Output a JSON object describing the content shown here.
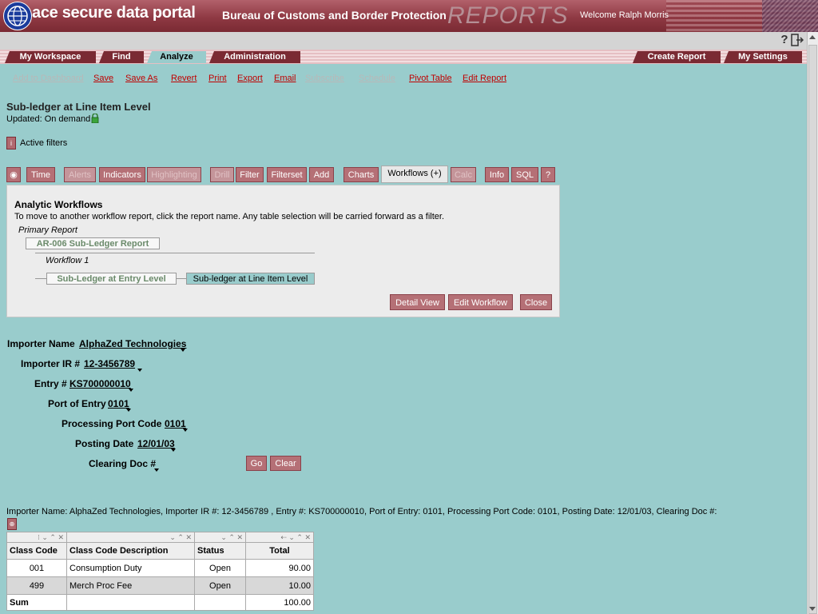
{
  "header": {
    "brand": "ace secure data portal",
    "agency": "Bureau of Customs and Border Protection",
    "reports": "REPORTS",
    "welcome": "Welcome Ralph Morris"
  },
  "nav": {
    "tabs": [
      "My Workspace",
      "Find",
      "Analyze",
      "Administration"
    ],
    "right_tabs": [
      "Create Report",
      "My Settings"
    ]
  },
  "actions": {
    "disabled_1": "Add to Dashboard",
    "save": "Save",
    "save_as": "Save As",
    "revert": "Revert",
    "print": "Print",
    "export": "Export",
    "email": "Email",
    "disabled_2": "Subscribe",
    "disabled_3": "Schedule",
    "pivot": "Pivot Table",
    "edit": "Edit Report"
  },
  "report": {
    "title": "Sub-ledger at Line Item Level",
    "updated": "Updated: On demand",
    "active_filters": "Active filters"
  },
  "toolbar": {
    "time": "Time",
    "alerts": "Alerts",
    "indicators": "Indicators",
    "highlighting": "Highlighting",
    "drill": "Drill",
    "filter": "Filter",
    "filterset": "Filterset",
    "add": "Add",
    "charts": "Charts",
    "workflows": "Workflows (+)",
    "calc": "Calc",
    "info": "Info",
    "sql": "SQL",
    "help": "?"
  },
  "workflow": {
    "title": "Analytic Workflows",
    "description": "To move to another workflow report, click the report name. Any table selection will be carried forward as a filter.",
    "primary_label": "Primary Report",
    "primary_report": "AR-006 Sub-Ledger Report",
    "workflow_label": "Workflow 1",
    "step_1": "Sub-Ledger at Entry Level",
    "step_2": "Sub-ledger at Line Item Level",
    "detail_view": "Detail View",
    "edit_workflow": "Edit Workflow",
    "close": "Close"
  },
  "prompts": {
    "importer_name_label": "Importer Name",
    "importer_name": "AlphaZed Technologies",
    "importer_ir_label": "Importer IR #",
    "importer_ir": "12-3456789",
    "entry_label": "Entry #",
    "entry": "KS700000010",
    "port_label": "Port of Entry",
    "port": "0101",
    "proc_port_label": "Processing Port Code",
    "proc_port": "0101",
    "posting_date_label": "Posting Date",
    "posting_date": "12/01/03",
    "clearing_doc_label": "Clearing Doc #",
    "go": "Go",
    "clear": "Clear"
  },
  "summary": "Importer Name: AlphaZed Technologies, Importer IR #: 12-3456789 , Entry #: KS700000010, Port of Entry: 0101, Processing Port Code: 0101, Posting Date: 12/01/03, Clearing Doc #:",
  "table": {
    "columns": [
      "Class Code",
      "Class Code Description",
      "Status",
      "Total"
    ],
    "rows": [
      [
        "001",
        "Consumption Duty",
        "Open",
        "90.00"
      ],
      [
        "499",
        "Merch Proc Fee",
        "Open",
        "10.00"
      ]
    ],
    "sum_label": "Sum",
    "sum_total": "100.00"
  },
  "colors": {
    "accent": "#7a2a33",
    "background": "#99cccc",
    "link": "#c00000"
  }
}
